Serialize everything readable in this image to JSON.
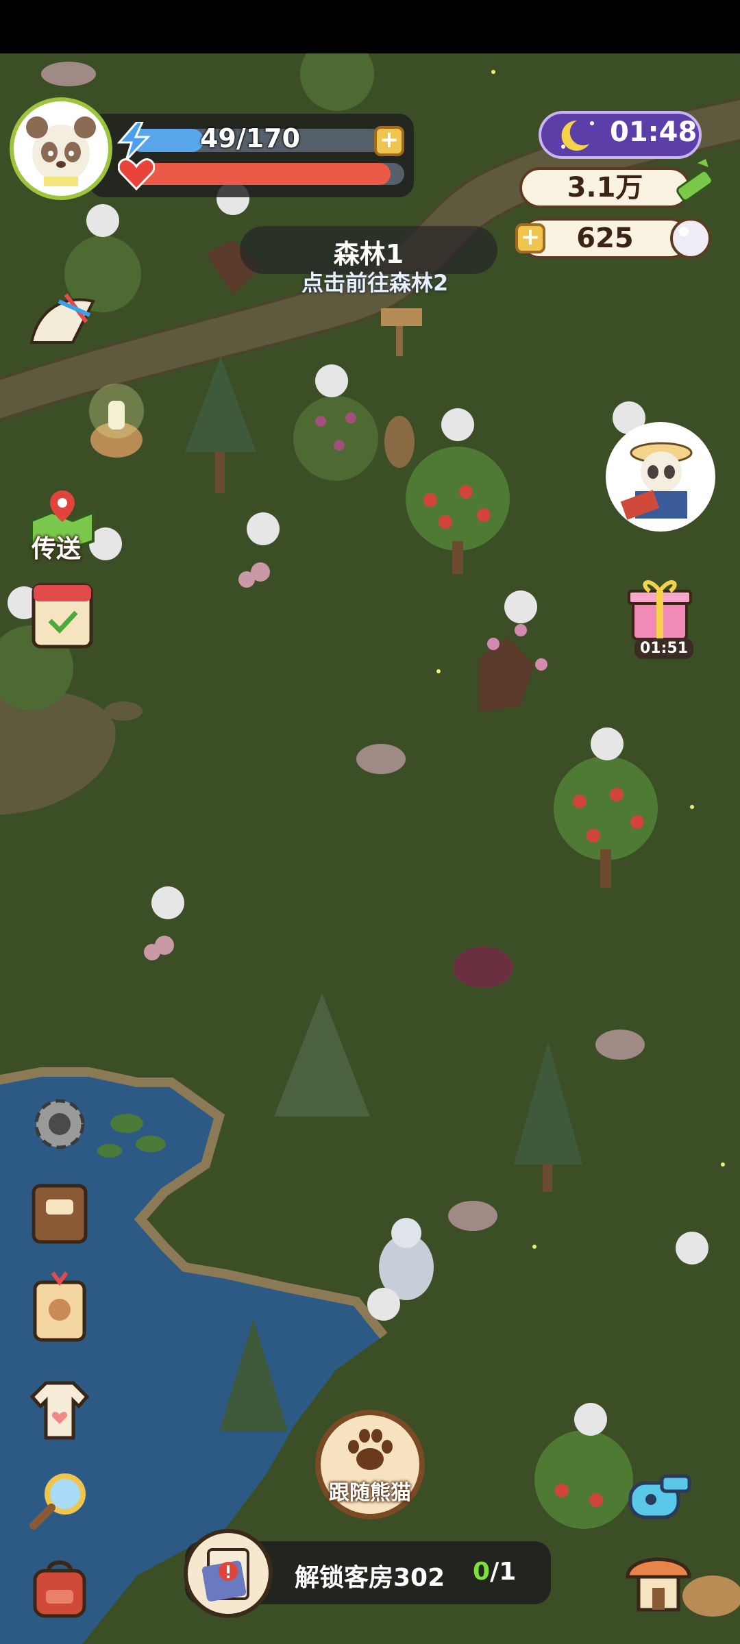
{
  "player": {
    "energy": {
      "current": 49,
      "max": 170,
      "label": "49/170",
      "fill_fraction": 0.288
    },
    "health_fill_fraction": 0.95
  },
  "clock": {
    "time": "01:48",
    "icon": "moon-stars-icon"
  },
  "currencies": {
    "bamboo": {
      "value": "3.1万",
      "icon": "bamboo-icon"
    },
    "pearl": {
      "value": "625",
      "icon": "pearl-icon"
    }
  },
  "location": {
    "title": "森林1",
    "hint": "点击前往森林2"
  },
  "side_menu": {
    "teleport_label": "传送"
  },
  "gift": {
    "timer": "01:51"
  },
  "follow_button": {
    "label": "跟随熊猫",
    "icon": "paw-icon"
  },
  "quest": {
    "label": "解锁客房302",
    "progress_done": "0",
    "progress_total": "/1"
  },
  "colors": {
    "grass": "#3b4e26",
    "path": "#5f5a3e",
    "water": "#2c5a84",
    "energy": "#59a6ea",
    "health": "#ec5a47",
    "accent_green": "#7ee03c"
  }
}
